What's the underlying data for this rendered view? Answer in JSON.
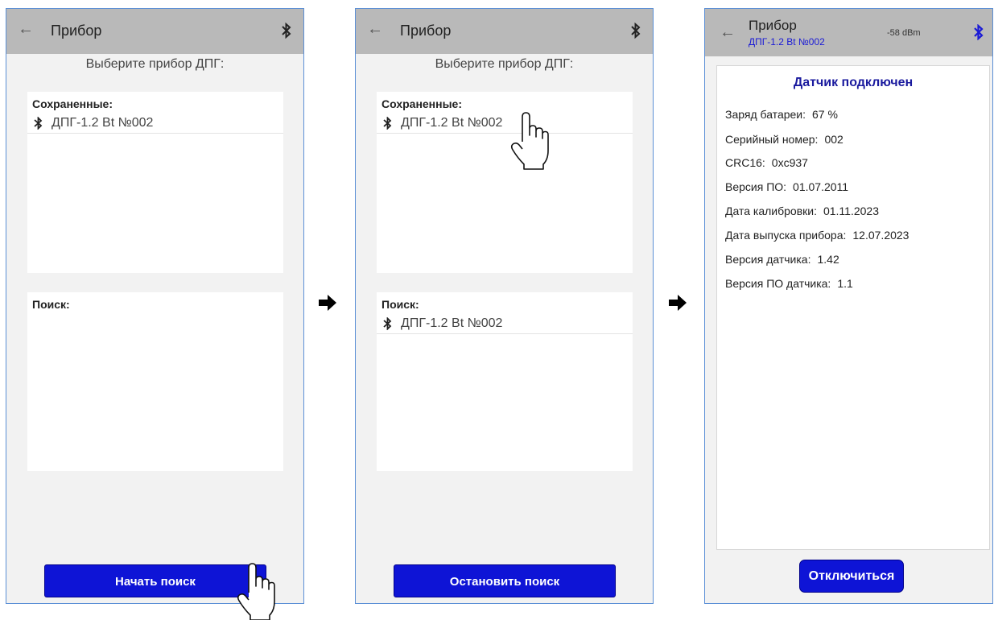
{
  "app": {
    "title": "Прибор",
    "icons": {
      "back": "arrow-left-icon",
      "bluetooth": "bluetooth-icon",
      "hand": "hand-pointer-icon",
      "flow": "arrow-right-icon"
    }
  },
  "screen1": {
    "hint": "Выберите прибор ДПГ:",
    "saved_label": "Сохраненные:",
    "saved_device": "ДПГ-1.2 Bt №002",
    "search_label": "Поиск:",
    "button": "Начать поиск"
  },
  "screen2": {
    "hint": "Выберите прибор ДПГ:",
    "saved_label": "Сохраненные:",
    "saved_device": "ДПГ-1.2 Bt №002",
    "search_label": "Поиск:",
    "found_device": "ДПГ-1.2 Bt №002",
    "button": "Остановить поиск"
  },
  "screen3": {
    "device": "ДПГ-1.2 Bt №002",
    "signal": "-58 dBm",
    "status": "Датчик подключен",
    "rows": [
      {
        "label": "Заряд батареи:",
        "value": "67 %"
      },
      {
        "label": "Серийный номер:",
        "value": "002"
      },
      {
        "label": "CRC16:",
        "value": "0xc937"
      },
      {
        "label": "Версия ПО:",
        "value": "01.07.2011"
      },
      {
        "label": "Дата калибровки:",
        "value": "01.11.2023"
      },
      {
        "label": "Дата выпуска прибора:",
        "value": "12.07.2023"
      },
      {
        "label": "Версия датчика:",
        "value": "1.42"
      },
      {
        "label": "Версия ПО датчика:",
        "value": "1.1"
      }
    ],
    "button": "Отключиться"
  },
  "colors": {
    "accent": "#0e14d6",
    "appbar": "#b9b9b9",
    "title_blue": "#1a1a9e",
    "bluetooth_blue": "#1a1ad6"
  }
}
